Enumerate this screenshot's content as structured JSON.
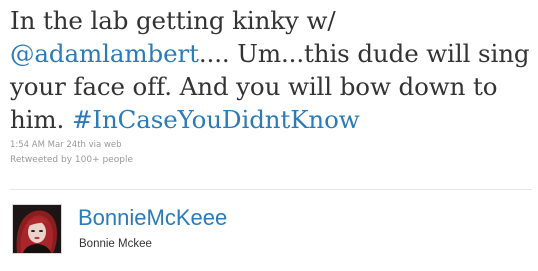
{
  "tweet": {
    "text_before_mention": "In the lab getting kinky w/ ",
    "mention": "@adamlambert",
    "text_after_mention": ".... Um...this dude will sing your face off. And you will bow down to him. ",
    "hashtag": "#InCaseYouDidntKnow",
    "timestamp": "1:54 AM Mar 24th",
    "via_prefix": " via ",
    "via_source": "web",
    "retweeted_by": "Retweeted by 100+ people"
  },
  "author": {
    "screen_name": "BonnieMcKeee",
    "full_name": "Bonnie Mckee",
    "avatar_icon": "user-avatar-photo"
  },
  "colors": {
    "link": "#2b7bb9",
    "text": "#333333",
    "meta": "#999999"
  }
}
